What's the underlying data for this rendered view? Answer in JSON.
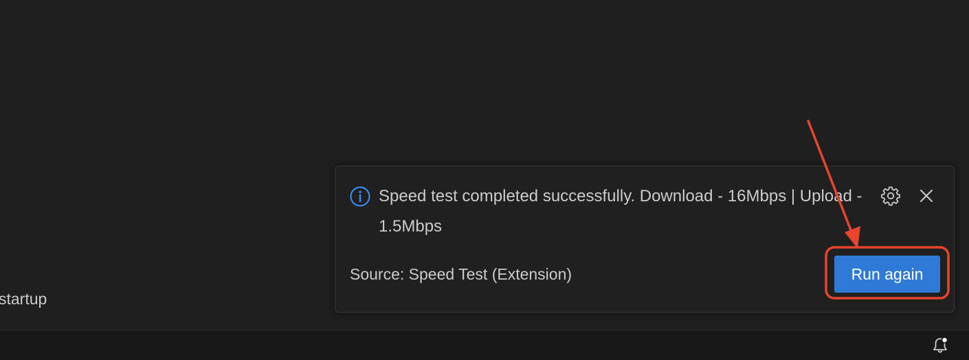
{
  "editor": {
    "partial_text": "startup"
  },
  "notification": {
    "icon": "info-icon",
    "message": "Speed test completed successfully. Download - 16Mbps | Upload - 1.5Mbps",
    "source": "Source: Speed Test (Extension)",
    "action_label": "Run again",
    "settings_icon": "gear-icon",
    "close_icon": "close-icon"
  },
  "status_bar": {
    "notification_icon": "bell-dot-icon"
  },
  "colors": {
    "background": "#1f1f1f",
    "toast_background": "#202020",
    "button": "#2f7ad6",
    "info_icon": "#3794ff",
    "annotation": "#e8442e"
  }
}
